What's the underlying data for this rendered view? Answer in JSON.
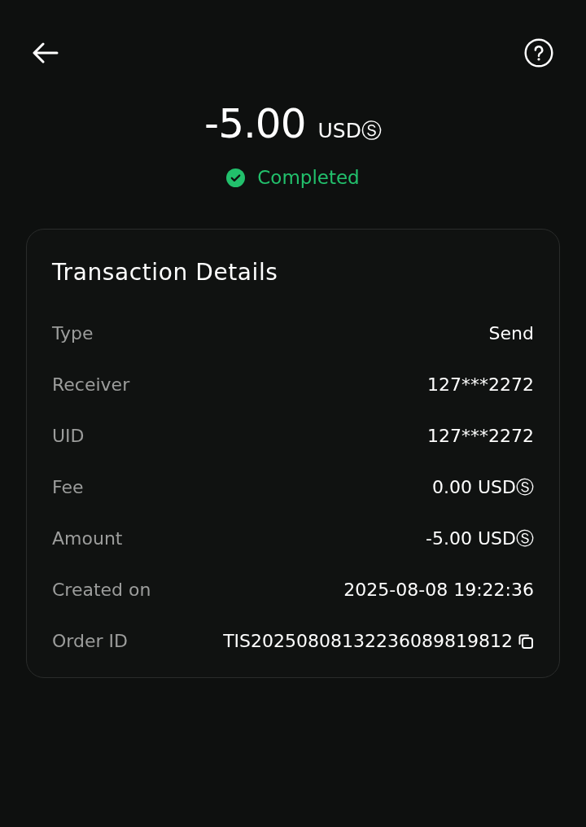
{
  "summary": {
    "amount": "-5.00",
    "currency": "USDⓈ",
    "status": {
      "kind": "success",
      "label": "Completed"
    }
  },
  "details": {
    "title": "Transaction Details",
    "rows": [
      {
        "label": "Type",
        "value": "Send"
      },
      {
        "label": "Receiver",
        "value": "127***2272"
      },
      {
        "label": "UID",
        "value": "127***2272"
      },
      {
        "label": "Fee",
        "value": "0.00 USDⓈ"
      },
      {
        "label": "Amount",
        "value": "-5.00 USDⓈ"
      },
      {
        "label": "Created on",
        "value": "2025-08-08 19:22:36"
      },
      {
        "label": "Order ID",
        "value": "TIS20250808132236089819812",
        "copyable": true
      }
    ]
  }
}
